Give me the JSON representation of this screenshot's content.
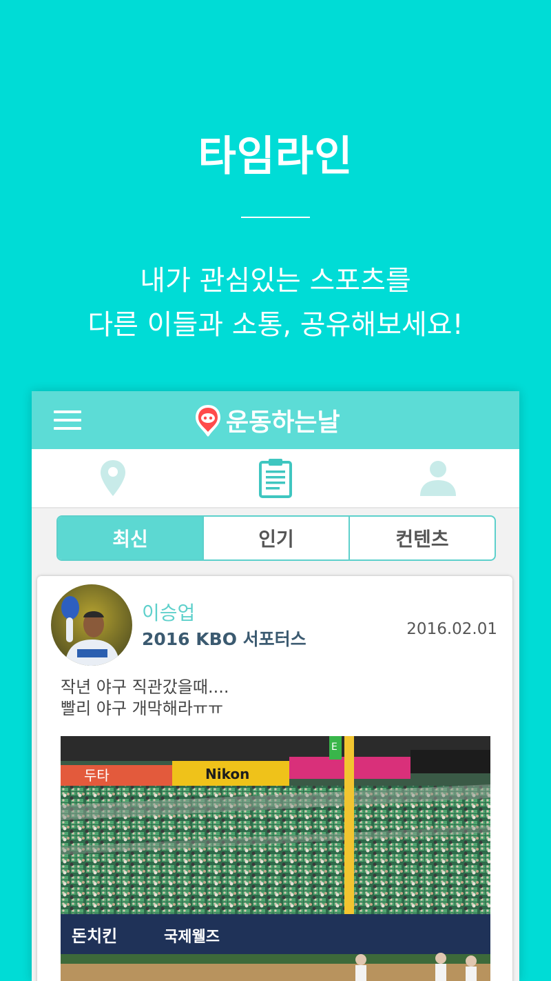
{
  "promo": {
    "title": "타임라인",
    "subtitle_line1": "내가 관심있는 스포츠를",
    "subtitle_line2": "다른 이들과 소통, 공유해보세요!"
  },
  "app": {
    "brand": "운동하는날",
    "nav_icons": [
      "location-pin-icon",
      "clipboard-icon",
      "user-profile-icon"
    ],
    "tabs": [
      "최신",
      "인기",
      "컨텐츠"
    ],
    "active_tab": "최신"
  },
  "post": {
    "author_name": "이승업",
    "author_group": "2016 KBO 서포터스",
    "date": "2016.02.01",
    "text_line1": "작년 야구 직관갔을때....",
    "text_line2": "빨리 야구 개막해라ㅠㅠ",
    "image_signs": [
      "두타",
      "Nikon",
      "돈치킨",
      "국제웰즈",
      "E"
    ]
  },
  "colors": {
    "background": "#00dcd6",
    "app_bar": "#5cdcd6",
    "accent": "#5cd0cb",
    "author_name": "#5ed0cb",
    "author_group": "#3b5a70",
    "logo_mark": "#ff4b4b"
  }
}
